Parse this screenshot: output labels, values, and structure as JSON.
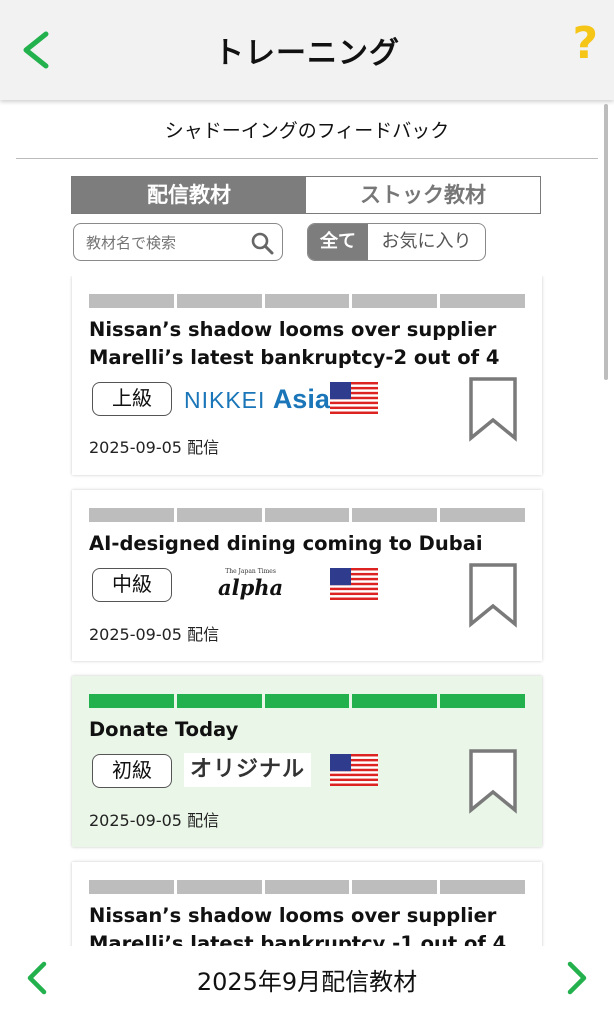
{
  "header": {
    "title": "トレーニング",
    "help_label": "?"
  },
  "subtitle": "シャドーイングのフィードバック",
  "tabs": [
    {
      "label": "配信教材",
      "active": true
    },
    {
      "label": "ストック教材",
      "active": false
    }
  ],
  "search": {
    "placeholder": "教材名で検索",
    "value": ""
  },
  "filter": {
    "all_label": "全て",
    "favorites_label": "お気に入り",
    "selected": "全て"
  },
  "cards": [
    {
      "title": "Nissan’s shadow looms over supplier Marelli’s latest bankruptcy-2 out of 4",
      "level": "上級",
      "source_text": "NIKKEI",
      "source_text_bold": "Asia",
      "date": "2025-09-05 配信",
      "progress_completed": 0,
      "progress_total": 5
    },
    {
      "title": "AI-designed dining coming to Dubai",
      "level": "中級",
      "source_small": "The Japan Times",
      "source_text": "alpha",
      "date": "2025-09-05 配信",
      "progress_completed": 0,
      "progress_total": 5
    },
    {
      "title": "Donate Today",
      "level": "初級",
      "source_text": "オリジナル",
      "date": "2025-09-05 配信",
      "progress_completed": 5,
      "progress_total": 5
    },
    {
      "title": "Nissan’s shadow looms over supplier Marelli’s latest bankruptcy -1 out of 4",
      "progress_completed": 0,
      "progress_total": 5
    }
  ],
  "footer": {
    "title": "2025年9月配信教材"
  },
  "colors": {
    "accent_green": "#22b14c",
    "help_yellow": "#f5c518",
    "nikkei_blue": "#1a76b8",
    "completed_bg": "#eaf7e8"
  }
}
